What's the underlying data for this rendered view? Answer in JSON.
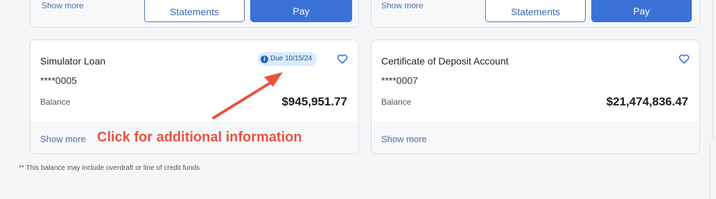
{
  "top_cards": [
    {
      "show_more_label": "Show more",
      "statements_label": "Statements",
      "pay_label": "Pay"
    },
    {
      "show_more_label": "Show more",
      "statements_label": "Statements",
      "pay_label": "Pay"
    }
  ],
  "accounts": [
    {
      "name": "Simulator Loan",
      "masked_number": "****0005",
      "balance_label": "Balance",
      "balance": "$945,951.77",
      "due_badge": "Due 10/15/24",
      "show_more_label": "Show more"
    },
    {
      "name": "Certificate of Deposit Account",
      "masked_number": "****0007",
      "balance_label": "Balance",
      "balance": "$21,474,836.47",
      "show_more_label": "Show more"
    }
  ],
  "annotation": {
    "text": "Click for additional information",
    "color": "#e8533f"
  },
  "footnote": "** This balance may include overdraft or line of credit funds",
  "icons": {
    "favorite": "heart-outline-icon",
    "info": "info-icon"
  },
  "colors": {
    "primary": "#3a72d8",
    "badge_bg": "#d9ecff",
    "arrow": "#e8533f"
  }
}
